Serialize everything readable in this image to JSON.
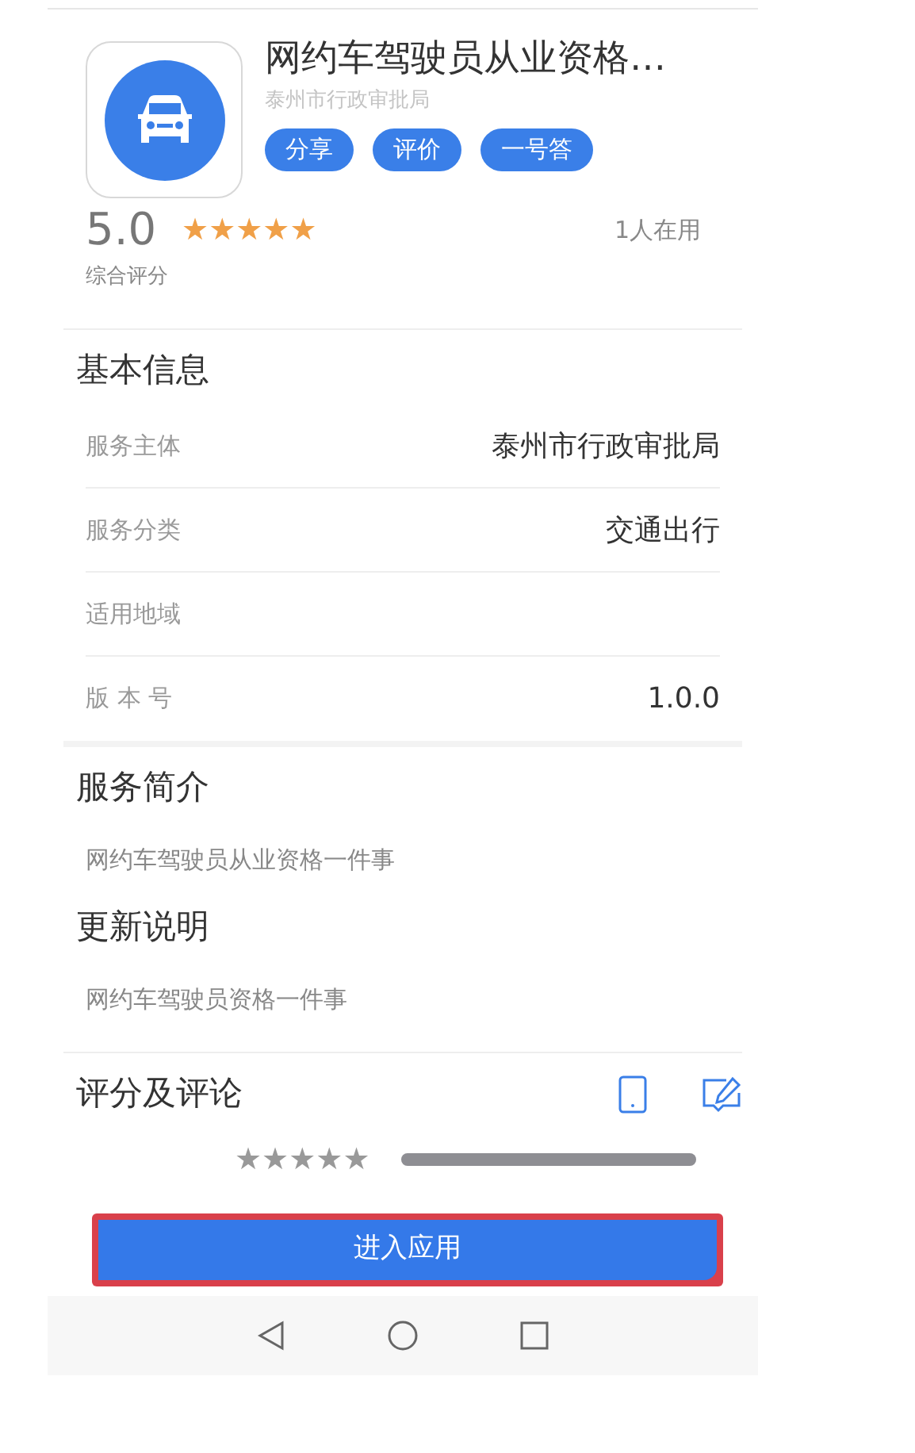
{
  "app": {
    "title": "网约车驾驶员从业资格…",
    "publisher": "泰州市行政审批局",
    "actions": [
      "分享",
      "评价",
      "一号答"
    ]
  },
  "rating": {
    "score": "5.0",
    "stars": 5,
    "label": "综合评分",
    "users": "1人在用"
  },
  "basic_info": {
    "heading": "基本信息",
    "rows": [
      {
        "label": "服务主体",
        "value": "泰州市行政审批局"
      },
      {
        "label": "服务分类",
        "value": "交通出行"
      },
      {
        "label": "适用地域"
      },
      {
        "label": "版 本 号",
        "value": "1.0.0"
      }
    ]
  },
  "intro": {
    "heading": "服务简介",
    "text": "网约车驾驶员从业资格一件事"
  },
  "update": {
    "heading": "更新说明",
    "text": "网约车驾驶员资格一件事"
  },
  "reviews": {
    "heading": "评分及评论",
    "histogram": [
      {
        "stars": 5,
        "level": 1
      }
    ]
  },
  "enter_button": {
    "label": "进入应用",
    "highlighted": true
  }
}
